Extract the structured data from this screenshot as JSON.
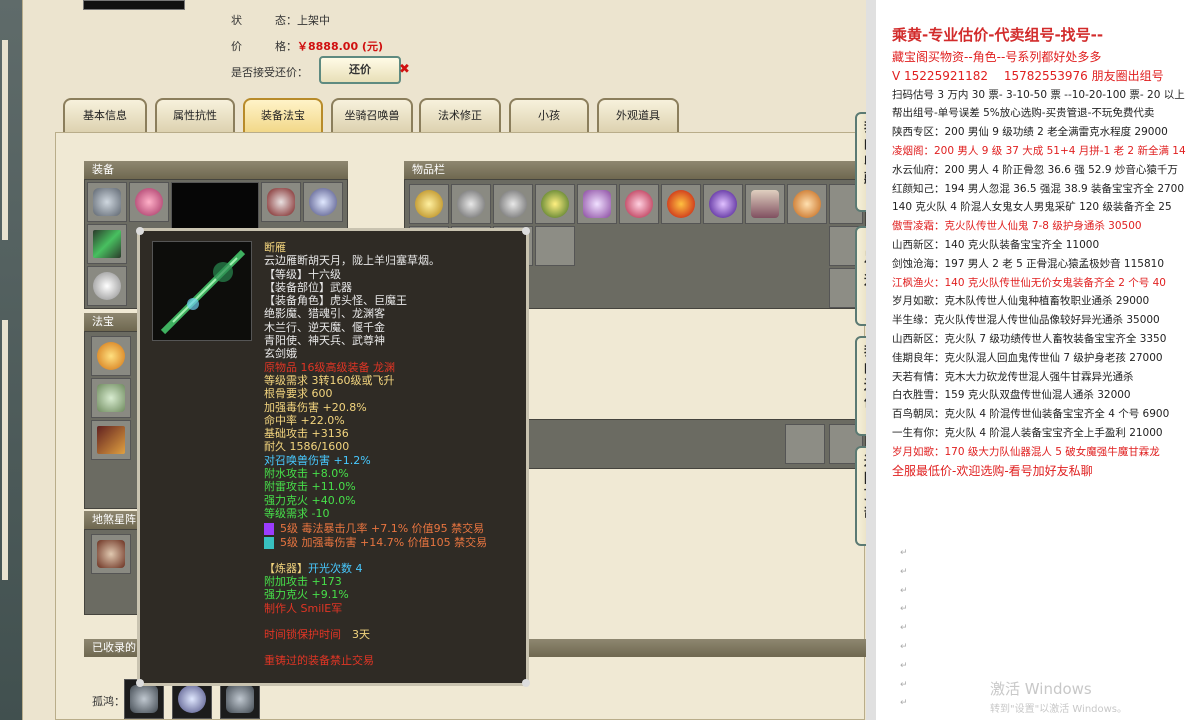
{
  "listing": {
    "status_label": "状　　　态：",
    "status_value": "上架中",
    "price_label": "价　　　格：",
    "price_value": "￥8888.00 (元)",
    "bargain_label": "是否接受还价：",
    "bargain_button": "还价"
  },
  "tabs": [
    "基本信息",
    "属性抗性",
    "装备法宝",
    "坐骑召唤兽",
    "法术修正",
    "小孩",
    "外观道具"
  ],
  "sections": {
    "equipment": "装备",
    "inventory": "物品栏",
    "treasure": "法宝",
    "dilian": "地煞星阵",
    "collected": "已收录的",
    "guhong_label": "孤鸿："
  },
  "tooltip": {
    "name": "断雁",
    "lines": [
      {
        "text": "云边雁断胡天月，陇上羊归塞草烟。",
        "color": "white"
      },
      {
        "text": "【等级】十六级",
        "color": "white"
      },
      {
        "text": "【装备部位】武器",
        "color": "white"
      },
      {
        "text": "【装备角色】虎头怪、巨魔王",
        "color": "white"
      },
      {
        "text": "绝影魔、猎魂引、龙渊客",
        "color": "white"
      },
      {
        "text": "木兰行、逆天魔、偃千金",
        "color": "white"
      },
      {
        "text": "青阳使、神天兵、武尊神",
        "color": "white"
      },
      {
        "text": "玄剑娥",
        "color": "white"
      },
      {
        "text": "原物品 16级高级装备 龙渊",
        "color": "red"
      },
      {
        "text": "等级需求 3转160级或飞升",
        "color": "yellow"
      },
      {
        "text": "根骨要求 600",
        "color": "yellow"
      },
      {
        "text": "加强毒伤害 +20.8%",
        "color": "yellow"
      },
      {
        "text": "命中率 +22.0%",
        "color": "yellow"
      },
      {
        "text": "基础攻击 +3136",
        "color": "yellow"
      },
      {
        "text": "耐久 1586/1600",
        "color": "yellow"
      },
      {
        "text": "对召唤兽伤害 +1.2%",
        "color": "cyan"
      },
      {
        "text": "附水攻击 +8.0%",
        "color": "green"
      },
      {
        "text": "附雷攻击 +11.0%",
        "color": "green"
      },
      {
        "text": "强力克火 +40.0%",
        "color": "green"
      },
      {
        "text": "等级需求 -10",
        "color": "green"
      }
    ],
    "gems": [
      {
        "text": "5级 毒法暴击几率 +7.1% 价值95 禁交易",
        "color": "#9b3cff"
      },
      {
        "text": "5级 加强毒伤害 +14.7% 价值105 禁交易",
        "color": "#38c0c0"
      }
    ],
    "refine_label": "【炼器】",
    "refine_value": "开光次数 4",
    "refine_lines": [
      "附加攻击 +173",
      "强力克火 +9.1%"
    ],
    "maker": "制作人 SmilE军",
    "protect_label": "时间锁保护时间",
    "protect_value": "3天",
    "forbid": "重铸过的装备禁止交易"
  },
  "side_buttons": [
    "我的收藏",
    "足迹",
    "我的还价",
    "返回顶部"
  ],
  "doc": {
    "title": "乘黄-专业估价-代卖组号-找号--",
    "lines": [
      {
        "text": "藏宝阁买物资--角色--号系列都好处多多",
        "red": true,
        "big": true
      },
      {
        "text": "V 15225921182 　15782553976 朋友圈出组号",
        "red": true,
        "big": true
      },
      {
        "text": "扫码估号 3 万内 30 票- 3-10-50 票 --10-20-100 票- 20 以上",
        "red": false
      },
      {
        "text": "帮出组号-单号误差 5%放心选购-买贵管退-不玩免费代卖",
        "red": false
      },
      {
        "text": "陕西专区：200 男仙 9 级功绩 2 老全满雷克水程度 29000",
        "red": false
      },
      {
        "text": "凌烟阁：200 男人 9 级 37 大成 51+4 月拼-1 老 2 新全满 14",
        "red": true
      },
      {
        "text": "水云仙府：200 男人 4 阶正骨忽 36.6 强 52.9 炒音心猿千万",
        "red": false
      },
      {
        "text": "红颜知己：194 男人忽混 36.5 强混 38.9 装备宝宝齐全 2700",
        "red": false
      },
      {
        "text": "140 克火队 4 阶混人女鬼女人男鬼采矿 120 级装备齐全 25",
        "red": false
      },
      {
        "text": "傲雪凌霜：克火队传世人仙鬼 7-8 级护身通杀 30500",
        "red": true
      },
      {
        "text": "山西新区：140 克火队装备宝宝齐全 11000",
        "red": false
      },
      {
        "text": "剑蚀沧海：197 男人 2 老 5 正骨混心猿孟极妙音 115810",
        "red": false
      },
      {
        "text": "江枫渔火：140 克火队传世仙无价女鬼装备齐全 2 个号 40",
        "red": true
      },
      {
        "text": "岁月如歌：克木队传世人仙鬼种植畜牧职业通杀 29000",
        "red": false
      },
      {
        "text": "半生缘：克火队传世混人传世仙品像较好异光通杀 35000",
        "red": false
      },
      {
        "text": "山西新区：克火队 7 级功绩传世人畜牧装备宝宝齐全 3350",
        "red": false
      },
      {
        "text": "佳期良年：克火队混人回血鬼传世仙 7 级护身老孩 27000",
        "red": false
      },
      {
        "text": "天若有情：克木大力砍龙传世混人强牛甘霖异光通杀",
        "red": false
      },
      {
        "text": "白衣胜雪：159 克火队双盘传世仙混人通杀 32000",
        "red": false
      },
      {
        "text": "百鸟朝凤：克火队 4 阶混传世仙装备宝宝齐全 4 个号 6900",
        "red": false
      },
      {
        "text": "一生有你：克火队 4 阶混人装备宝宝齐全上手盈利 21000",
        "red": false
      },
      {
        "text": "岁月如歌：170 级大力队仙器混人 5 破女魔强牛魔甘霖龙",
        "red": true
      },
      {
        "text": "全服最低价-欢迎选购-看号加好友私聊",
        "red": true,
        "big": true
      }
    ],
    "watermark": "激活 Windows",
    "watermark_sub": "转到\"设置\"以激活 Windows。"
  },
  "colors": {
    "price": "#d01010",
    "doc_red": "#e02020",
    "tooltip_bg": "#2f2b25"
  }
}
